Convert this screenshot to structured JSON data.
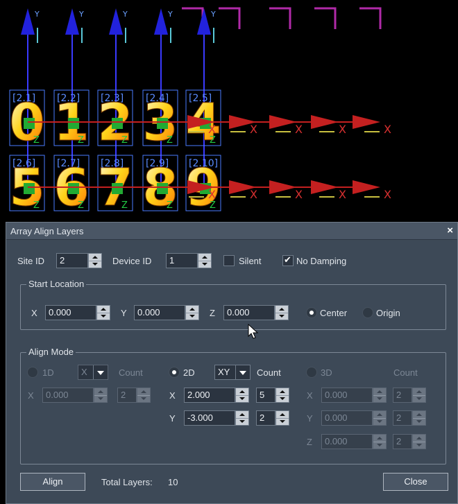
{
  "viewport": {
    "layer_labels": [
      "[2.1]",
      "[2.2]",
      "[2.3]",
      "[2.4]",
      "[2.5]",
      "[2.6]",
      "[2.7]",
      "[2.8]",
      "[2.9]",
      "[2.10]"
    ],
    "digits": [
      "0",
      "1",
      "2",
      "3",
      "4",
      "5",
      "6",
      "7",
      "8",
      "9"
    ],
    "axis_y": "Y",
    "axis_x": "X",
    "axis_z": "Z"
  },
  "dialog": {
    "title": "Array Align Layers",
    "close_icon": "×",
    "site_id_label": "Site ID",
    "site_id_value": "2",
    "device_id_label": "Device ID",
    "device_id_value": "1",
    "silent_label": "Silent",
    "silent_checked": false,
    "no_damping_label": "No Damping",
    "no_damping_checked": true,
    "start_location": {
      "legend": "Start Location",
      "x_label": "X",
      "x_value": "0.000",
      "y_label": "Y",
      "y_value": "0.000",
      "z_label": "Z",
      "z_value": "0.000",
      "center_label": "Center",
      "origin_label": "Origin",
      "selected": "Center"
    },
    "align_mode": {
      "legend": "Align Mode",
      "mode_1d": {
        "label": "1D",
        "axis": "X",
        "count_label": "Count",
        "x_label": "X",
        "x_value": "0.000",
        "count_value": "2"
      },
      "mode_2d": {
        "label": "2D",
        "axis": "XY",
        "count_label": "Count",
        "x_label": "X",
        "x_value": "2.000",
        "x_count": "5",
        "y_label": "Y",
        "y_value": "-3.000",
        "y_count": "2"
      },
      "mode_3d": {
        "label": "3D",
        "count_label": "Count",
        "x_label": "X",
        "x_value": "0.000",
        "x_count": "2",
        "y_label": "Y",
        "y_value": "0.000",
        "y_count": "2",
        "z_label": "Z",
        "z_value": "0.000",
        "z_count": "2"
      },
      "selected": "2D"
    },
    "align_button": "Align",
    "total_layers_label": "Total Layers:",
    "total_layers_value": "10",
    "close_button": "Close"
  }
}
